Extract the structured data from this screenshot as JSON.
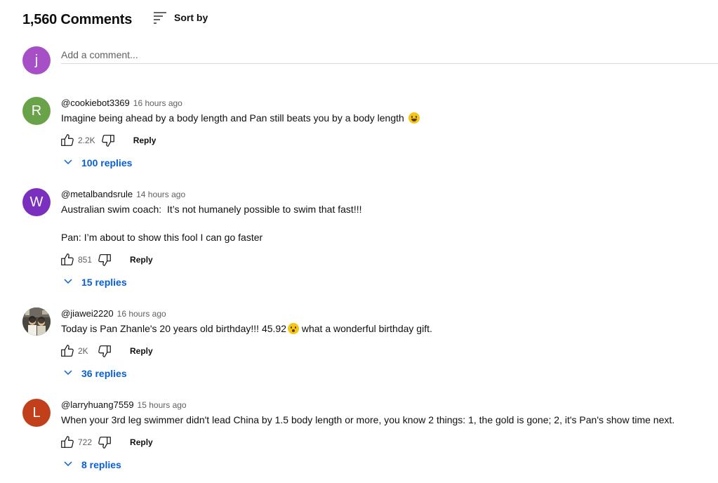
{
  "header": {
    "comment_count": "1,560 Comments",
    "sort_label": "Sort by"
  },
  "add_comment": {
    "avatar_letter": "j",
    "avatar_color": "#a64fc6",
    "placeholder": "Add a comment..."
  },
  "comments": [
    {
      "avatar_letter": "R",
      "avatar_color": "#6aa24a",
      "author": "@cookiebot3369",
      "time": "16 hours ago",
      "text": "Imagine being ahead by a body length and Pan still beats you by a body length",
      "emoji": "laughing-emoji",
      "likes": "2.2K",
      "reply_label": "Reply",
      "replies_label": "100 replies"
    },
    {
      "avatar_letter": "W",
      "avatar_color": "#7b2fbe",
      "author": "@metalbandsrule",
      "time": "14 hours ago",
      "text": "Australian swim coach:  It’s not humanely possible to swim that fast!!!\n\nPan: I’m about to show this fool I can go faster",
      "likes": "851",
      "reply_label": "Reply",
      "replies_label": "15 replies"
    },
    {
      "avatar_letter": "",
      "avatar_color": "#3d3a36",
      "author": "@jiawei2220",
      "time": "16 hours ago",
      "text_before": "Today is Pan Zhanle's 20 years old birthday!!! 45.92",
      "text_after": " what a wonderful birthday gift.",
      "emoji": "surprised-emoji",
      "likes": "2K",
      "reply_label": "Reply",
      "replies_label": "36 replies"
    },
    {
      "avatar_letter": "L",
      "avatar_color": "#c1401b",
      "author": "@larryhuang7559",
      "time": "15 hours ago",
      "text": "When your 3rd leg swimmer didn't lead China by 1.5 body length or more, you know 2 things: 1, the gold is gone; 2, it's Pan's show time next.",
      "likes": "722",
      "reply_label": "Reply",
      "replies_label": "8 replies"
    }
  ],
  "colors": {
    "link_blue": "#065fd4",
    "secondary_text": "#606060"
  }
}
